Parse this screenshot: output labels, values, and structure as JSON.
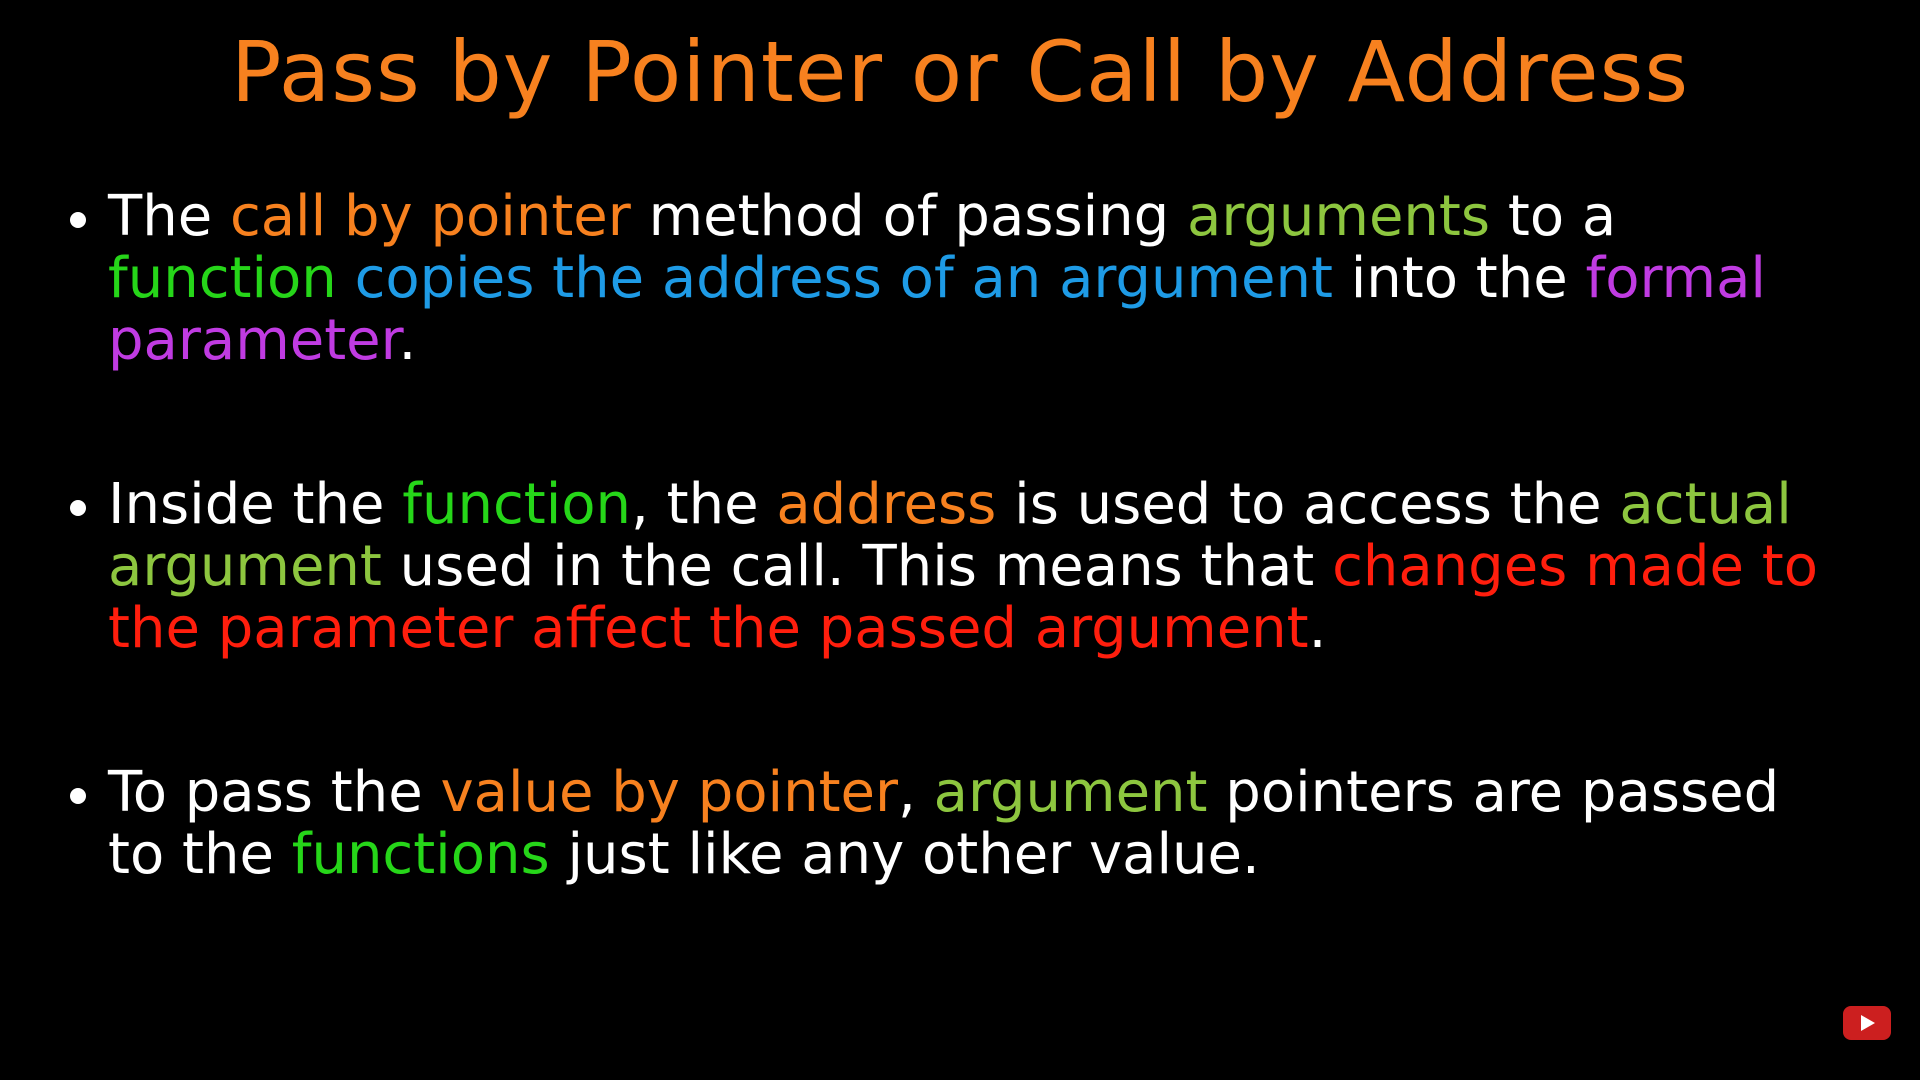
{
  "title": "Pass by Pointer or Call by Address",
  "colors": {
    "background": "#000000",
    "white": "#ffffff",
    "orange": "#f7811f",
    "light_green": "#8dc63f",
    "green": "#26d619",
    "blue": "#1e9be6",
    "purple": "#c03be2",
    "red": "#ff1e0d"
  },
  "bullets": [
    {
      "segments": [
        {
          "text": "The ",
          "color": "white"
        },
        {
          "text": "call by pointer",
          "color": "orange"
        },
        {
          "text": " method of passing ",
          "color": "white"
        },
        {
          "text": "arguments",
          "color": "light_green"
        },
        {
          "text": " to a ",
          "color": "white"
        },
        {
          "text": "function",
          "color": "green"
        },
        {
          "text": " ",
          "color": "white"
        },
        {
          "text": "copies the address of an argument",
          "color": "blue"
        },
        {
          "text": " into the ",
          "color": "white"
        },
        {
          "text": "formal parameter",
          "color": "purple"
        },
        {
          "text": ".",
          "color": "white"
        }
      ]
    },
    {
      "segments": [
        {
          "text": "Inside the ",
          "color": "white"
        },
        {
          "text": "function",
          "color": "green"
        },
        {
          "text": ", the ",
          "color": "white"
        },
        {
          "text": "address",
          "color": "orange"
        },
        {
          "text": " is used to access the ",
          "color": "white"
        },
        {
          "text": "actual argument",
          "color": "light_green"
        },
        {
          "text": " used in the call. This means that ",
          "color": "white"
        },
        {
          "text": "changes made to the parameter affect the passed argument",
          "color": "red"
        },
        {
          "text": ".",
          "color": "white"
        }
      ]
    },
    {
      "segments": [
        {
          "text": "To pass the ",
          "color": "white"
        },
        {
          "text": "value by pointer",
          "color": "orange"
        },
        {
          "text": ", ",
          "color": "white"
        },
        {
          "text": "argument",
          "color": "light_green"
        },
        {
          "text": " pointers are passed to the ",
          "color": "white"
        },
        {
          "text": "functions",
          "color": "green"
        },
        {
          "text": " just like any other value.",
          "color": "white"
        }
      ]
    }
  ],
  "player": {
    "icon": "youtube-play-icon"
  }
}
